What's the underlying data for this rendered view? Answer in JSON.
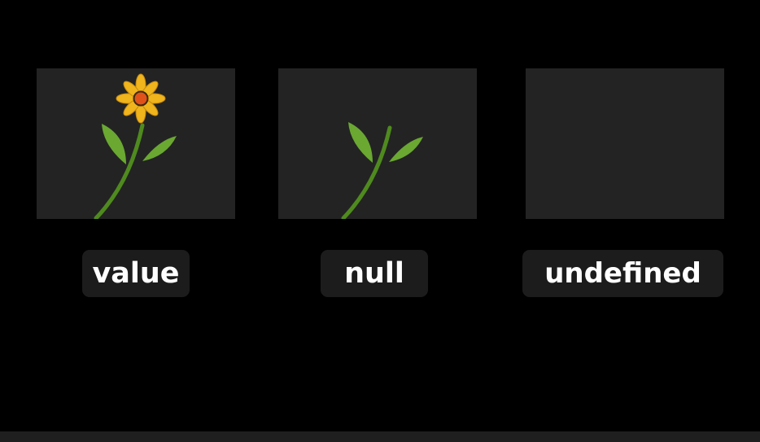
{
  "cards": [
    {
      "label": "value",
      "content": "flower-with-stem-and-leaves"
    },
    {
      "label": "null",
      "content": "stem-with-leaves-only"
    },
    {
      "label": "undefined",
      "content": "empty"
    }
  ],
  "colors": {
    "background": "#000000",
    "panel": "#232323",
    "label_bg": "#1c1c1c",
    "label_text": "#ffffff",
    "stem": "#4f8a1e",
    "leaf": "#6aa832",
    "petal": "#f0b41c",
    "flower_center": "#e0521a"
  },
  "icons": [
    "flower-icon",
    "stem-icon"
  ]
}
